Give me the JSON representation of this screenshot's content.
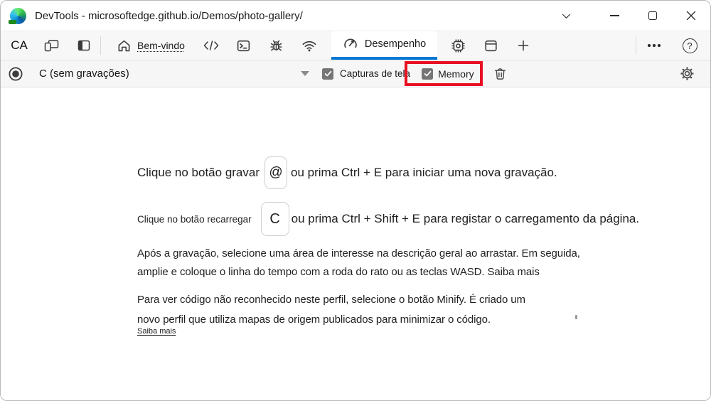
{
  "titlebar": {
    "title": "DevTools - microsoftedge.github.io/Demos/photo-gallery/"
  },
  "toolbar": {
    "inspect_label": "CA",
    "welcome_tab": "Bem-vindo",
    "performance_tab": "Desempenho"
  },
  "perfbar": {
    "recordings": "C (sem gravações)",
    "screenshots": "Capturas de tela",
    "memory": "Memory"
  },
  "content": {
    "line1": {
      "prefix": "Clique no botão gravar",
      "key": "@",
      "suffix": "ou prima Ctrl + E para iniciar uma nova gravação."
    },
    "line2": {
      "prefix": "Clique no botão recarregar",
      "key": "C",
      "suffix": "ou prima Ctrl + Shift + E para registar o carregamento da página."
    },
    "para_zoom": "Após a gravação, selecione uma área de interesse na descrição geral ao arrastar. Em seguida, amplie e coloque o linha do tempo com a roda do rato ou as teclas WASD. Saiba mais",
    "para_minify": "Para ver código não reconhecido neste perfil, selecione o botão Minify. É criado um novo perfil que utiliza mapas de origem publicados para minimizar o código.",
    "learn_more": "Saiba mais"
  },
  "colors": {
    "accent_blue": "#0078d4",
    "highlight_red": "#e81123",
    "checkbox_gray": "#757575"
  },
  "icons": [
    "edge-dev-logo",
    "chevron-down-icon",
    "minimize-icon",
    "maximize-icon",
    "close-icon",
    "device-emulation-icon",
    "dock-panel-icon",
    "home-icon",
    "code-icon",
    "console-icon",
    "debug-icon",
    "network-icon",
    "performance-icon",
    "memory-chip-icon",
    "application-icon",
    "add-tab-icon",
    "more-options-icon",
    "help-icon",
    "record-icon",
    "dropdown-caret-icon",
    "checkbox-checked-icon",
    "trash-icon",
    "settings-gear-icon"
  ]
}
